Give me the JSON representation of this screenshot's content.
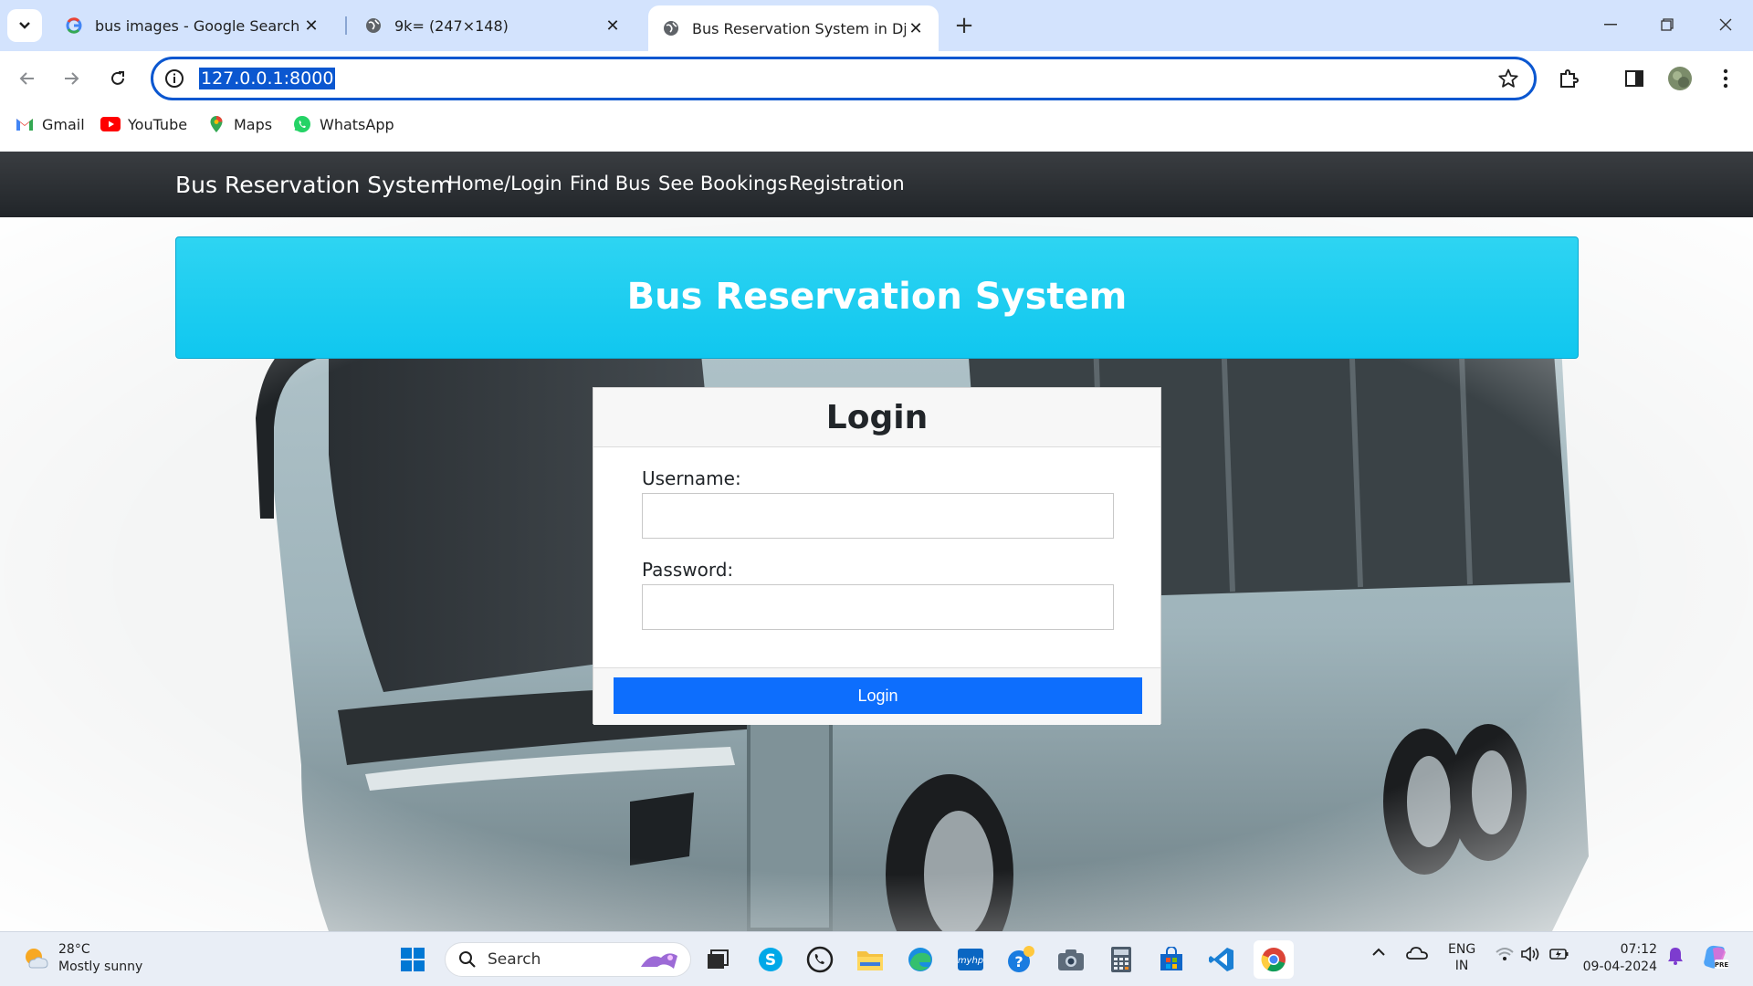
{
  "browser": {
    "tabs": [
      {
        "title": "bus images - Google Search",
        "favicon": "google-icon"
      },
      {
        "title": "9k= (247×148)",
        "favicon": "globe-icon"
      },
      {
        "title": "Bus Reservation System in Djan",
        "favicon": "globe-icon",
        "active": true
      }
    ],
    "url": "127.0.0.1:8000",
    "bookmarks": [
      {
        "label": "Gmail",
        "icon": "gmail-icon"
      },
      {
        "label": "YouTube",
        "icon": "youtube-icon"
      },
      {
        "label": "Maps",
        "icon": "maps-icon"
      },
      {
        "label": "WhatsApp",
        "icon": "whatsapp-icon"
      }
    ]
  },
  "site": {
    "brand": "Bus Reservation System",
    "nav": [
      "Home/Login",
      "Find Bus",
      "See Bookings",
      "Registration"
    ],
    "hero_title": "Bus Reservation System"
  },
  "login": {
    "title": "Login",
    "username_label": "Username:",
    "password_label": "Password:",
    "username_value": "",
    "password_value": "",
    "button": "Login"
  },
  "taskbar": {
    "weather_temp": "28°C",
    "weather_desc": "Mostly sunny",
    "search_label": "Search",
    "lang_top": "ENG",
    "lang_bottom": "IN",
    "time": "07:12",
    "date": "09-04-2024"
  },
  "colors": {
    "accent": "#0b57d0",
    "navbar": "#212529",
    "hero": "#17c9f0",
    "primary_button": "#0d6efd"
  }
}
